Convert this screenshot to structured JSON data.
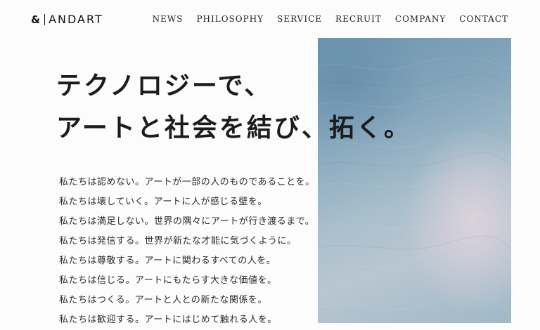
{
  "header": {
    "logo": {
      "symbol": "&",
      "wordmark": "ANDART"
    },
    "nav": [
      {
        "label": "NEWS"
      },
      {
        "label": "PHILOSOPHY"
      },
      {
        "label": "SERVICE"
      },
      {
        "label": "RECRUIT"
      },
      {
        "label": "COMPANY"
      },
      {
        "label": "CONTACT"
      }
    ]
  },
  "hero": {
    "headline": [
      "テクノロジーで、",
      "アートと社会を結び、拓く。"
    ],
    "lines": [
      "私たちは認めない。アートが一部の人のものであることを。",
      "私たちは壊していく。アートに人が感じる壁を。",
      "私たちは満足しない。世界の隅々にアートが行き渡るまで。",
      "私たちは発信する。世界が新たな才能に気づくように。",
      "私たちは尊敬する。アートに関わるすべての人を。",
      "私たちは信じる。アートにもたらす大きな価値を。",
      "私たちはつくる。アートと人との新たな関係を。",
      "私たちは歓迎する。アートにはじめて触れる人を。"
    ]
  },
  "colors": {
    "background": "#fcfcfc",
    "text": "#1f1f1f",
    "image_top": "#6e95af",
    "image_highlight": "#e2d4de"
  }
}
